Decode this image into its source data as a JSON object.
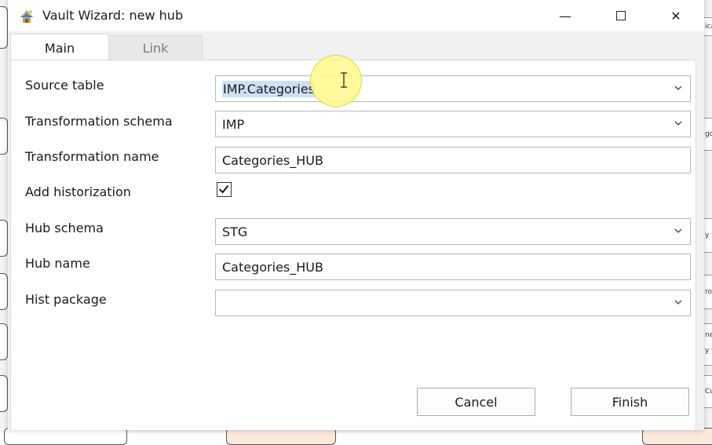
{
  "window": {
    "title": "Vault Wizard: new hub",
    "controls": {
      "minimize": "—",
      "maximize": "",
      "close": "✕"
    }
  },
  "tabs": [
    {
      "label": "Main",
      "active": true
    },
    {
      "label": "Link",
      "active": false
    }
  ],
  "form": {
    "source_table": {
      "label": "Source table",
      "value": "IMP.Categories",
      "type": "combobox",
      "selected": true
    },
    "transformation_schema": {
      "label": "Transformation schema",
      "value": "IMP",
      "type": "combobox"
    },
    "transformation_name": {
      "label": "Transformation name",
      "value": "Categories_HUB",
      "type": "text"
    },
    "add_historization": {
      "label": "Add historization",
      "checked": true
    },
    "hub_schema": {
      "label": "Hub schema",
      "value": "STG",
      "type": "combobox"
    },
    "hub_name": {
      "label": "Hub name",
      "value": "Categories_HUB",
      "type": "text"
    },
    "hist_package": {
      "label": "Hist package",
      "value": "",
      "type": "combobox"
    }
  },
  "buttons": {
    "cancel": "Cancel",
    "finish": "Finish"
  },
  "background_fragments": [
    "ica",
    "go",
    "y S",
    "ro",
    "ne\ny v",
    "Cus"
  ],
  "colors": {
    "selection": "#cde0f7",
    "cursor_highlight": "#fffa8c",
    "client_bg": "#f0f0f0"
  },
  "icons": {
    "app": "vault-wizard-icon",
    "dropdown": "chevron-down-icon",
    "check": "checkmark-icon",
    "cursor": "text-cursor-icon"
  }
}
